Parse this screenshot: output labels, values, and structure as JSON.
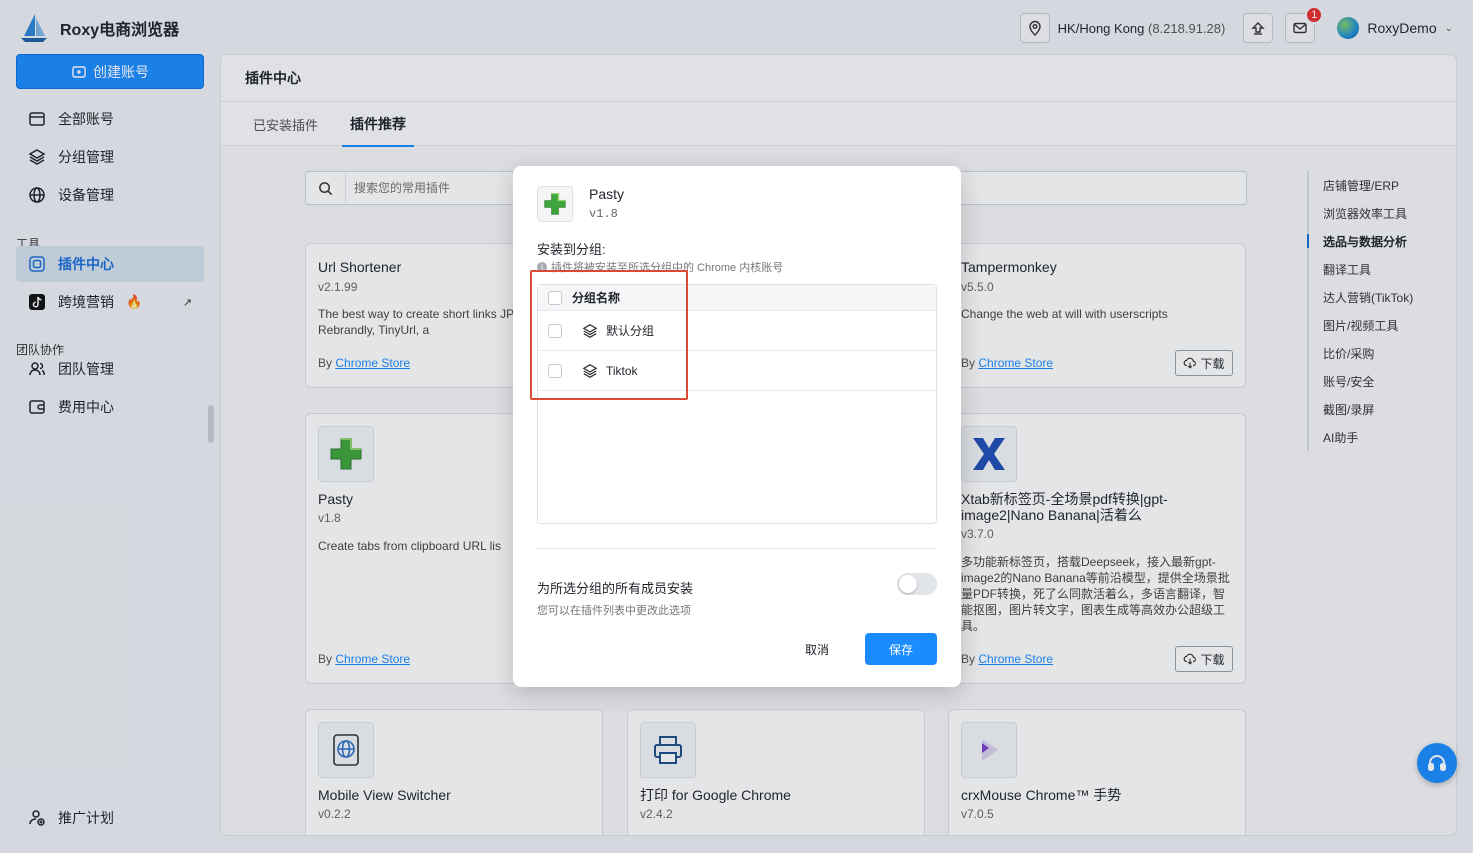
{
  "app": {
    "title": "Roxy电商浏览器"
  },
  "sidebar": {
    "create_label": "创建账号",
    "items_top": [
      {
        "label": "全部账号",
        "icon": "card-icon"
      },
      {
        "label": "分组管理",
        "icon": "layers-icon"
      },
      {
        "label": "设备管理",
        "icon": "globe-icon"
      }
    ],
    "section_tools": "工具",
    "items_tools": [
      {
        "label": "插件中心",
        "icon": "plugin-icon"
      },
      {
        "label": "跨境营销",
        "icon": "tiktok-icon"
      }
    ],
    "section_team": "团队协作",
    "items_team": [
      {
        "label": "团队管理",
        "icon": "team-icon"
      },
      {
        "label": "费用中心",
        "icon": "wallet-icon"
      }
    ],
    "bottom_item": "推广计划"
  },
  "topbar": {
    "location": "HK/Hong Kong",
    "ip": "(8.218.91.28)",
    "notification_count": "1",
    "username": "RoxyDemo"
  },
  "main": {
    "title": "插件中心",
    "tabs": [
      "已安装插件",
      "插件推荐"
    ],
    "search_placeholder": "搜索您的常用插件",
    "download_label": "下载",
    "by_prefix": "By",
    "store_label": "Chrome Store",
    "cards": [
      {
        "name": "Url Shortener",
        "version": "v2.1.99",
        "desc": "The best way to create short links JPEG.ly, Bitly, Rebrandly, TinyUrl, a"
      },
      {
        "name": "Tampermonkey",
        "version": "v5.5.0",
        "desc": "Change the web at will with userscripts"
      },
      {
        "name": "Pasty",
        "version": "v1.8",
        "desc": "Create tabs from clipboard URL lis"
      },
      {
        "name": "Xtab新标签页-全场景pdf转换|gpt-image2|Nano Banana|活着么",
        "version": "v3.7.0",
        "desc": "多功能新标签页，搭载Deepseek，接入最新gpt-image2的Nano Banana等前沿模型，提供全场景批量PDF转换，死了么同款活着么，多语言翻译，智能抠图，图片转文字，图表生成等高效办公超级工具。"
      },
      {
        "name": "Mobile View Switcher",
        "version": "v0.2.2",
        "desc": ""
      },
      {
        "name": "打印 for Google Chrome",
        "version": "v2.4.2",
        "desc": ""
      },
      {
        "name": "crxMouse Chrome™ 手势",
        "version": "v7.0.5",
        "desc": ""
      }
    ],
    "categories": [
      "店铺管理/ERP",
      "浏览器效率工具",
      "选品与数据分析",
      "翻译工具",
      "达人营销(TikTok)",
      "图片/视频工具",
      "比价/采购",
      "账号/安全",
      "截图/录屏",
      "AI助手"
    ]
  },
  "modal": {
    "plugin_name": "Pasty",
    "plugin_version": "v1.8",
    "install_label": "安装到分组:",
    "hint": "插件将被安装至所选分组中的 Chrome 内核账号",
    "table_header": "分组名称",
    "groups": [
      "默认分组",
      "Tiktok"
    ],
    "all_members_title": "为所选分组的所有成员安装",
    "all_members_sub": "您可以在插件列表中更改此选项",
    "cancel_label": "取消",
    "save_label": "保存"
  }
}
